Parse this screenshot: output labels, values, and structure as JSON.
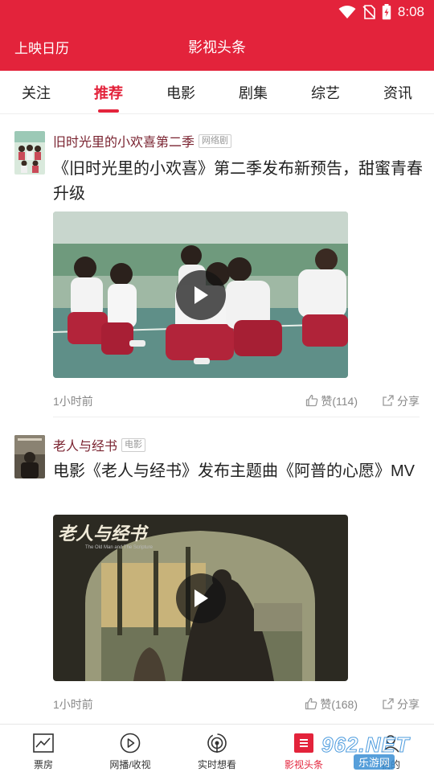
{
  "status": {
    "time": "8:08",
    "icons": [
      "wifi-icon",
      "no-sim-icon",
      "battery-charging-icon"
    ]
  },
  "header": {
    "left_link": "上映日历",
    "title": "影视头条"
  },
  "tabs": [
    {
      "label": "关注",
      "active": false
    },
    {
      "label": "推荐",
      "active": true
    },
    {
      "label": "电影",
      "active": false
    },
    {
      "label": "剧集",
      "active": false
    },
    {
      "label": "综艺",
      "active": false
    },
    {
      "label": "资讯",
      "active": false
    }
  ],
  "feed": [
    {
      "source": "旧时光里的小欢喜第二季",
      "tag": "网络剧",
      "title": "《旧时光里的小欢喜》第二季发布新预告，甜蜜青春升级",
      "time": "1小时前",
      "like_label": "赞(114)",
      "share_label": "分享"
    },
    {
      "source": "老人与经书",
      "tag": "电影",
      "title": "电影《老人与经书》发布主题曲《阿普的心愿》MV",
      "video_overlay_title": "老人与经书",
      "video_overlay_sub": "The Old Man and The Scripture",
      "time": "1小时前",
      "like_label": "赞(168)",
      "share_label": "分享"
    }
  ],
  "bottom_nav": [
    {
      "label": "票房",
      "icon": "chart-icon",
      "active": false
    },
    {
      "label": "网播/收视",
      "icon": "play-circle-icon",
      "active": false
    },
    {
      "label": "实时想看",
      "icon": "broadcast-icon",
      "active": false
    },
    {
      "label": "影视头条",
      "icon": "headline-icon",
      "active": true
    },
    {
      "label": "我的",
      "icon": "user-icon",
      "active": false
    }
  ],
  "watermark": {
    "line1": "962.NET",
    "line2": "乐游网"
  },
  "colors": {
    "brand": "#e3233b",
    "source_text": "#7a2330"
  }
}
